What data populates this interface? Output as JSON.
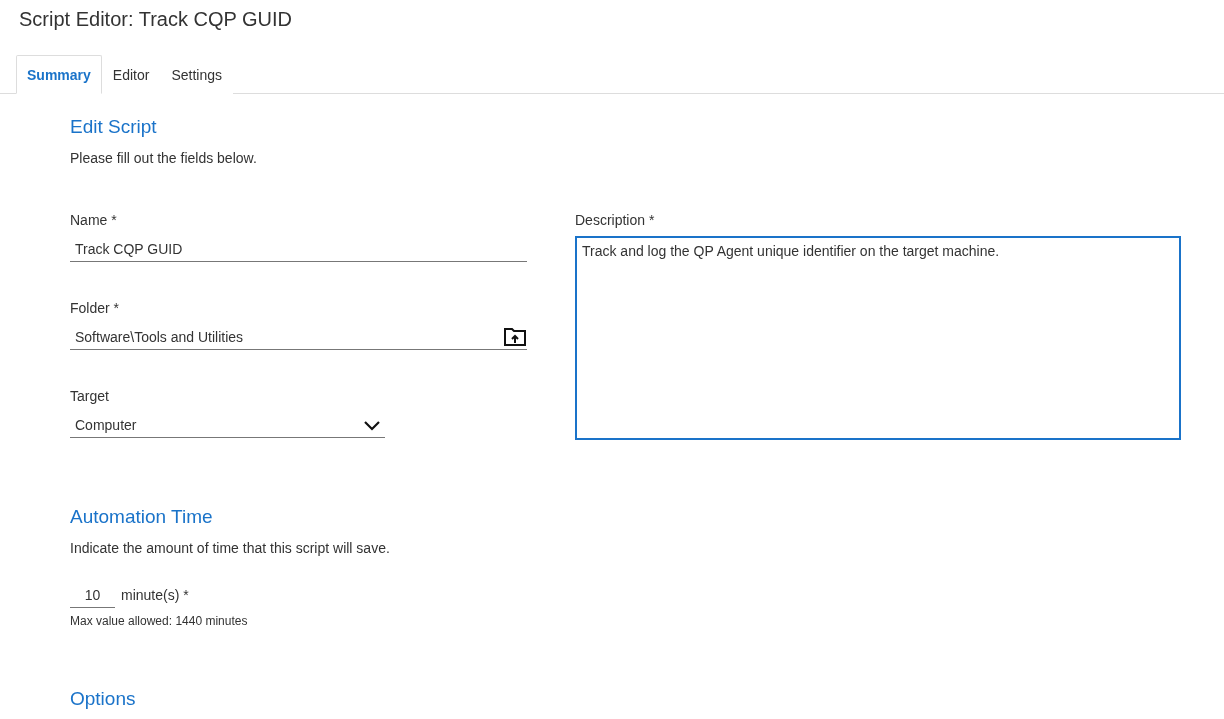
{
  "window": {
    "title": "Script Editor: Track CQP GUID"
  },
  "tabs": [
    {
      "label": "Summary",
      "selected": true
    },
    {
      "label": "Editor",
      "selected": false
    },
    {
      "label": "Settings",
      "selected": false
    }
  ],
  "edit_script": {
    "heading": "Edit Script",
    "intro": "Please fill out the fields below.",
    "name": {
      "label": "Name *",
      "value": "Track CQP GUID"
    },
    "folder": {
      "label": "Folder *",
      "value": "Software\\Tools and Utilities"
    },
    "target": {
      "label": "Target",
      "value": "Computer"
    },
    "description": {
      "label": "Description *",
      "value": "Track and log the QP Agent unique identifier on the target machine."
    }
  },
  "automation_time": {
    "heading": "Automation Time",
    "intro": "Indicate the amount of time that this script will save.",
    "value": "10",
    "unit": "minute(s) *",
    "hint": "Max value allowed: 1440 minutes"
  },
  "options": {
    "heading": "Options"
  }
}
